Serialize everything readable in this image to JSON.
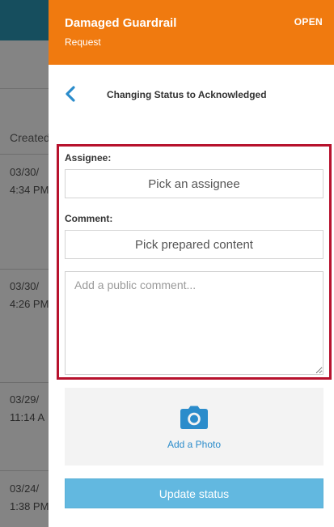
{
  "background": {
    "column_header": "Created",
    "rows": [
      {
        "date": "03/30/",
        "time": "4:34 PM"
      },
      {
        "date": "03/30/",
        "time": "4:26 PM"
      },
      {
        "date": "03/29/",
        "time": "11:14 A"
      },
      {
        "date": "03/24/",
        "time": "1:38 PM"
      }
    ]
  },
  "panel": {
    "title": "Damaged Guardrail",
    "subtitle": "Request",
    "status": "OPEN",
    "step_title": "Changing Status to Acknowledged",
    "back_icon": "chevron-left-icon"
  },
  "form": {
    "assignee_label": "Assignee:",
    "assignee_placeholder": "Pick an assignee",
    "comment_label": "Comment:",
    "prepared_content_placeholder": "Pick prepared content",
    "comment_placeholder": "Add a public comment..."
  },
  "photo": {
    "icon": "camera-icon",
    "label": "Add a Photo"
  },
  "actions": {
    "update_label": "Update status"
  },
  "colors": {
    "header_orange": "#f07a0f",
    "highlight_border": "#b7122d",
    "accent_blue": "#2b8ccb",
    "button_blue": "#62b8e0"
  }
}
